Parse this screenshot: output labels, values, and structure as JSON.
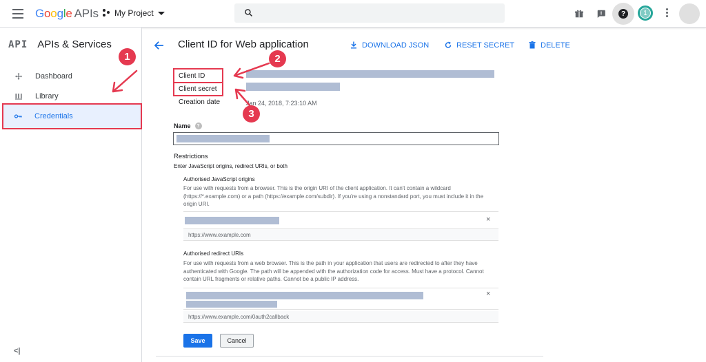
{
  "header": {
    "logo": {
      "G": "G",
      "o1": "o",
      "o2": "o",
      "g": "g",
      "l": "l",
      "e": "e",
      "apis": "APIs"
    },
    "project_name": "My Project",
    "notification_count": "1",
    "help_glyph": "?"
  },
  "sidebar": {
    "api_mark": "API",
    "title": "APIs & Services",
    "items": [
      {
        "label": "Dashboard",
        "icon": "dashboard-icon"
      },
      {
        "label": "Library",
        "icon": "library-icon"
      },
      {
        "label": "Credentials",
        "icon": "key-icon",
        "active": true
      }
    ],
    "collapse_glyph": "<|"
  },
  "main": {
    "title": "Client ID for Web application",
    "actions": {
      "download": "DOWNLOAD JSON",
      "reset": "RESET SECRET",
      "delete": "DELETE"
    },
    "fields": {
      "client_id_label": "Client ID",
      "client_secret_label": "Client secret",
      "creation_date_label": "Creation date",
      "creation_date_value": "Jan 24, 2018, 7:23:10 AM"
    },
    "name_label": "Name",
    "info_glyph": "?",
    "restrictions": {
      "title": "Restrictions",
      "subtitle": "Enter JavaScript origins, redirect URIs, or both",
      "origins": {
        "title": "Authorised JavaScript origins",
        "help": "For use with requests from a browser. This is the origin URI of the client application. It can't contain a wildcard (https://*.example.com) or a path (https://example.com/subdir). If you're using a nonstandard port, you must include it in the origin URI.",
        "placeholder": "https://www.example.com"
      },
      "redirects": {
        "title": "Authorised redirect URIs",
        "help": "For use with requests from a web browser. This is the path in your application that users are redirected to after they have authenticated with Google. The path will be appended with the authorization code for access. Must have a protocol. Cannot contain URL fragments or relative paths. Cannot be a public IP address.",
        "placeholder": "https://www.example.com/0auth2callback"
      },
      "remove_glyph": "×"
    },
    "buttons": {
      "save": "Save",
      "cancel": "Cancel"
    }
  },
  "annotations": {
    "badge1": "1",
    "badge2": "2",
    "badge3": "3"
  },
  "colors": {
    "accent": "#1a73e8",
    "annotation": "#e53950",
    "redaction": "#b0bdd4"
  }
}
